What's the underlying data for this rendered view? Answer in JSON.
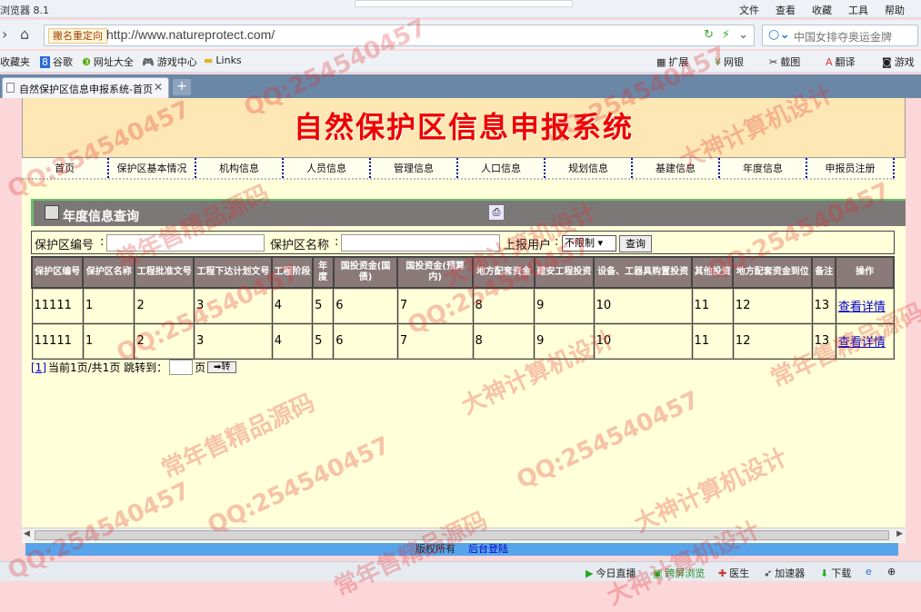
{
  "browser": {
    "title": "浏览器 8.1",
    "menus": [
      "文件",
      "查看",
      "收藏",
      "工具",
      "帮助"
    ],
    "redirect_badge": "撇名重定向",
    "url": "http://www.natureprotect.com/",
    "search_placeholder": "中国女排夺奥运金牌",
    "favorites": [
      "收藏夹",
      "谷歌",
      "网址大全",
      "游戏中心",
      "Links"
    ],
    "extensions": [
      "扩展",
      "网银",
      "截图",
      "翻译",
      "游戏"
    ],
    "tab_title": "自然保护区信息申报系统-首页",
    "status_items": [
      "今日直播",
      "跨屏浏览",
      "医生",
      "加速器",
      "下载"
    ]
  },
  "site": {
    "banner_title": "自然保护区信息申报系统",
    "nav": [
      "首页",
      "保护区基本情况",
      "机构信息",
      "人员信息",
      "管理信息",
      "人口信息",
      "规划信息",
      "基建信息",
      "年度信息",
      "申报员注册"
    ],
    "section_title": "年度信息查询",
    "search": {
      "id_label": "保护区编号",
      "name_label": "保护区名称",
      "user_label": "上报用户",
      "user_value": "不限制",
      "button": "查询"
    },
    "table": {
      "headers": [
        "保护区编号",
        "保护区名称",
        "工程批准文号",
        "工程下达计划文号",
        "工程阶段",
        "年度",
        "国投资金(国债)",
        "国投资金(预算内)",
        "地方配套资金",
        "建安工程投资",
        "设备、工器具购置投资",
        "其他投资",
        "地方配套资金到位",
        "备注",
        "操作"
      ],
      "rows": [
        [
          "11111",
          "1",
          "2",
          "3",
          "4",
          "5",
          "6",
          "7",
          "8",
          "9",
          "10",
          "11",
          "12",
          "13",
          "查看详情"
        ],
        [
          "11111",
          "1",
          "2",
          "3",
          "4",
          "5",
          "6",
          "7",
          "8",
          "9",
          "10",
          "11",
          "12",
          "13",
          "查看详情"
        ]
      ]
    },
    "pager": {
      "page_link": "[1]",
      "info": "当前1页/共1页 跳转到：",
      "unit": "页",
      "go": "➡转"
    },
    "footer": {
      "copyright": "版权所有",
      "admin_link": "后台登陆"
    }
  },
  "watermarks": [
    "QQ:254540457",
    "常年售精品源码",
    "大神计算机设计"
  ]
}
